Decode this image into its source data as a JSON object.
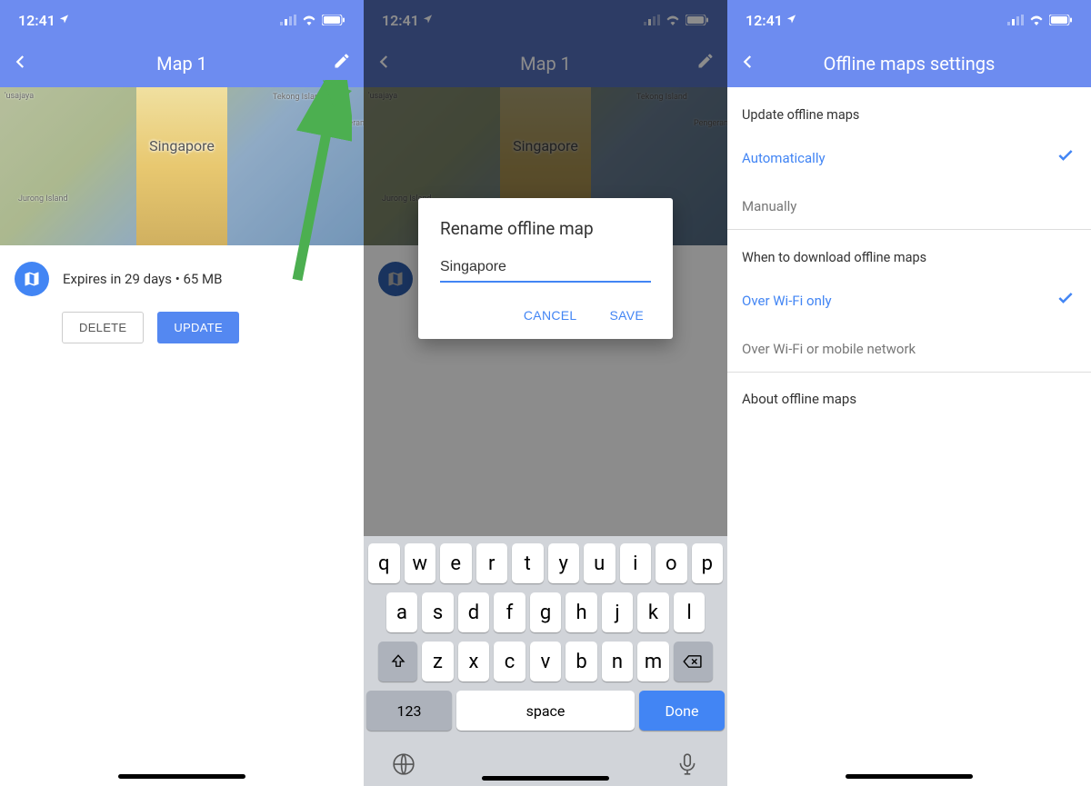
{
  "status": {
    "time": "12:41"
  },
  "screen1": {
    "title": "Map 1",
    "mapLabel": "Singapore",
    "places": {
      "tekong": "Tekong Island",
      "jurong": "Jurong Island",
      "usajaya": "'usajaya",
      "pengerang": "Pengerang"
    },
    "expires": "Expires in 29 days • 65 MB",
    "delete": "DELETE",
    "update": "UPDATE"
  },
  "screen2": {
    "title": "Map 1",
    "mapLabel": "Singapore",
    "places": {
      "tekong": "Tekong Island",
      "jurong": "Jurong Island",
      "usajaya": "'usajaya",
      "pengerang": "Pengerang"
    },
    "dialog": {
      "title": "Rename offline map",
      "value": "Singapore",
      "cancel": "CANCEL",
      "save": "SAVE"
    },
    "keyboard": {
      "row1": [
        "q",
        "w",
        "e",
        "r",
        "t",
        "y",
        "u",
        "i",
        "o",
        "p"
      ],
      "row2": [
        "a",
        "s",
        "d",
        "f",
        "g",
        "h",
        "j",
        "k",
        "l"
      ],
      "row3": [
        "z",
        "x",
        "c",
        "v",
        "b",
        "n",
        "m"
      ],
      "numKey": "123",
      "space": "space",
      "done": "Done"
    }
  },
  "screen3": {
    "title": "Offline maps settings",
    "updateHeader": "Update offline maps",
    "auto": "Automatically",
    "manual": "Manually",
    "whenHeader": "When to download offline maps",
    "wifiOnly": "Over Wi-Fi only",
    "wifiMobile": "Over Wi-Fi or mobile network",
    "about": "About offline maps"
  }
}
